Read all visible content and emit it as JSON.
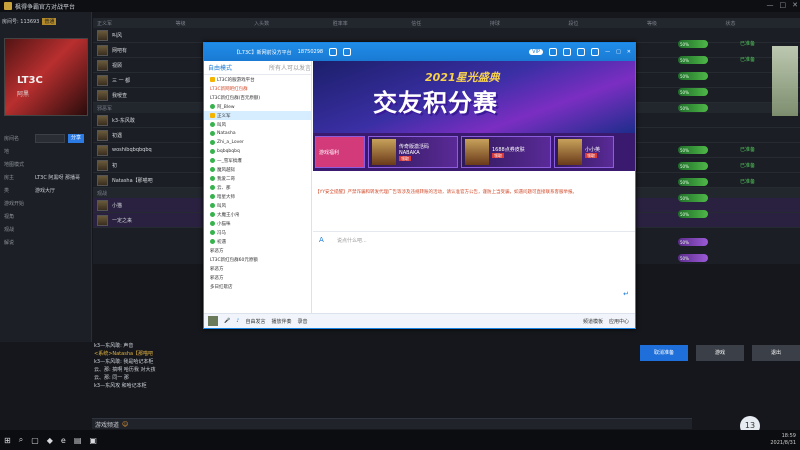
{
  "app": {
    "title": "枫得争霸官方对战平台",
    "window_controls": [
      "—",
      "□",
      "✕"
    ]
  },
  "left": {
    "room_label": "房间号: 113693",
    "room_tag": "普通",
    "avatar_text": "LT3C",
    "avatar_sub": "阿黑",
    "fields": [
      {
        "label": "房间名",
        "value": "LT3C"
      },
      {
        "label": "地",
        "value": ""
      },
      {
        "label": "地图模式",
        "value": ""
      },
      {
        "label": "房主",
        "value": "LT3C 阿黑呀 那播哥"
      },
      {
        "label": "类",
        "value": "游戏大厅"
      },
      {
        "label": "游戏开始",
        "value": ""
      },
      {
        "label": "视角",
        "value": ""
      },
      {
        "label": "观战",
        "value": ""
      },
      {
        "label": "解说",
        "value": ""
      }
    ],
    "join_button": "分享"
  },
  "roster": {
    "headers": [
      "正义军",
      "等级",
      "入头数",
      "胜率率",
      "信任",
      "持球",
      "段位",
      "等级",
      "状态"
    ],
    "team2_header": "邪恶军",
    "watch_header": "观战",
    "players_team1": [
      "叫风",
      "网吧有",
      "视顾",
      "三 一 都",
      "我嗳查"
    ],
    "players_team2": [
      "k3-东风敢",
      "初遇",
      "woshibqbqbqbq",
      "初",
      "Natasha【那喵吧"
    ],
    "watchers": [
      "小猫",
      "一定之来"
    ],
    "ready_label": "已准备"
  },
  "chat": {
    "lines": [
      "k3—东风敢: 声音",
      "<系统>Natasha【那喵吧",
      "k3—东风敢: 我是哈记本柜",
      "云、那: 搞啊 哈历我 对大孩",
      "云、那: 同一 那",
      "k3—东风攻 和哈记本柜"
    ],
    "input_placeholder": "游戏频道"
  },
  "buttons": {
    "cancel": "取消准备",
    "game_ready": "游戏",
    "leave": "退出"
  },
  "yy": {
    "title": "【L73C】新网前没方平台",
    "id": "18750298",
    "vip_label": "VIP",
    "left_header": "自由模式",
    "left_header_right": "所有人可以发言",
    "channel": "LT3C的服游戏平台",
    "sub_channel": "LT3C新网吧红包群",
    "sub2": "LT3C新红包群(百元原额)",
    "self_name": "阿_Blew",
    "group_name": "正义军",
    "members": [
      "叫风",
      "Natasha",
      "Zhi_a_Lover",
      "bqbqbqbq",
      "一_雪军搞爆",
      "魔风越狱",
      "我爱二哥",
      "云、那",
      "暗星大师",
      "叫风",
      "大魔王小帛",
      "小猫咪",
      "冯马",
      "初遇"
    ],
    "team2": "邪恶方",
    "sub_channel2": "LT3C新红包群60元原额",
    "bottom_channels": [
      "邪恶方",
      "邪恶方",
      "多日红歇店"
    ],
    "banner_year": "2021星光盛典",
    "banner_title": "交友积分赛",
    "promos": [
      {
        "title": "传奇版激活码",
        "tag": "NABAKA",
        "btn": "领取"
      },
      {
        "title": "1688点券皮肤",
        "tag": "",
        "btn": "领取"
      },
      {
        "title": "小小英",
        "tag": "",
        "btn": "领取"
      }
    ],
    "left_promo": "游戏福利",
    "notice": "【YY安全提醒】严禁诈骗和转发代理广告等涉及违规转账的活动，请认准官方公告，谨防上当受骗，如遇问题可直接联系客服举报。",
    "composer_placeholder": "说点什么吧...",
    "bottom": {
      "free_mode": "自由发言",
      "music": "播放伴奏",
      "record": "录音",
      "jieshuo": "频道模板",
      "app": "应用中心"
    }
  },
  "taskbar": {
    "time": "18:59",
    "date": "2021/8/31",
    "badge": "13"
  }
}
